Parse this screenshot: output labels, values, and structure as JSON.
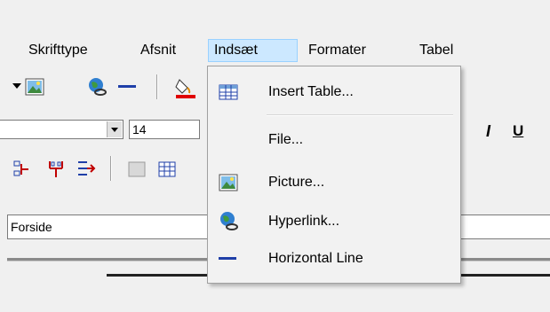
{
  "menubar": {
    "items": [
      {
        "label": "Skrifttype"
      },
      {
        "label": "Afsnit"
      },
      {
        "label": "Indsæt"
      },
      {
        "label": "Formater"
      },
      {
        "label": "Tabel"
      }
    ]
  },
  "toolbar": {
    "font_size_value": "14"
  },
  "dropdown": {
    "items": [
      {
        "label": "Insert Table...",
        "icon": "table-icon"
      },
      {
        "label": "File...",
        "icon": ""
      },
      {
        "label": "Picture...",
        "icon": "picture-icon"
      },
      {
        "label": "Hyperlink...",
        "icon": "hyperlink-globe-icon"
      },
      {
        "label": "Horizontal Line",
        "icon": "horizontal-line-icon"
      }
    ]
  },
  "path_field": {
    "value": "Forside"
  },
  "colors": {
    "menu_highlight": "#cce8ff",
    "menu_highlight_border": "#99d1ff",
    "line_blue": "#1f3fa8",
    "fill_red": "#e00000"
  }
}
